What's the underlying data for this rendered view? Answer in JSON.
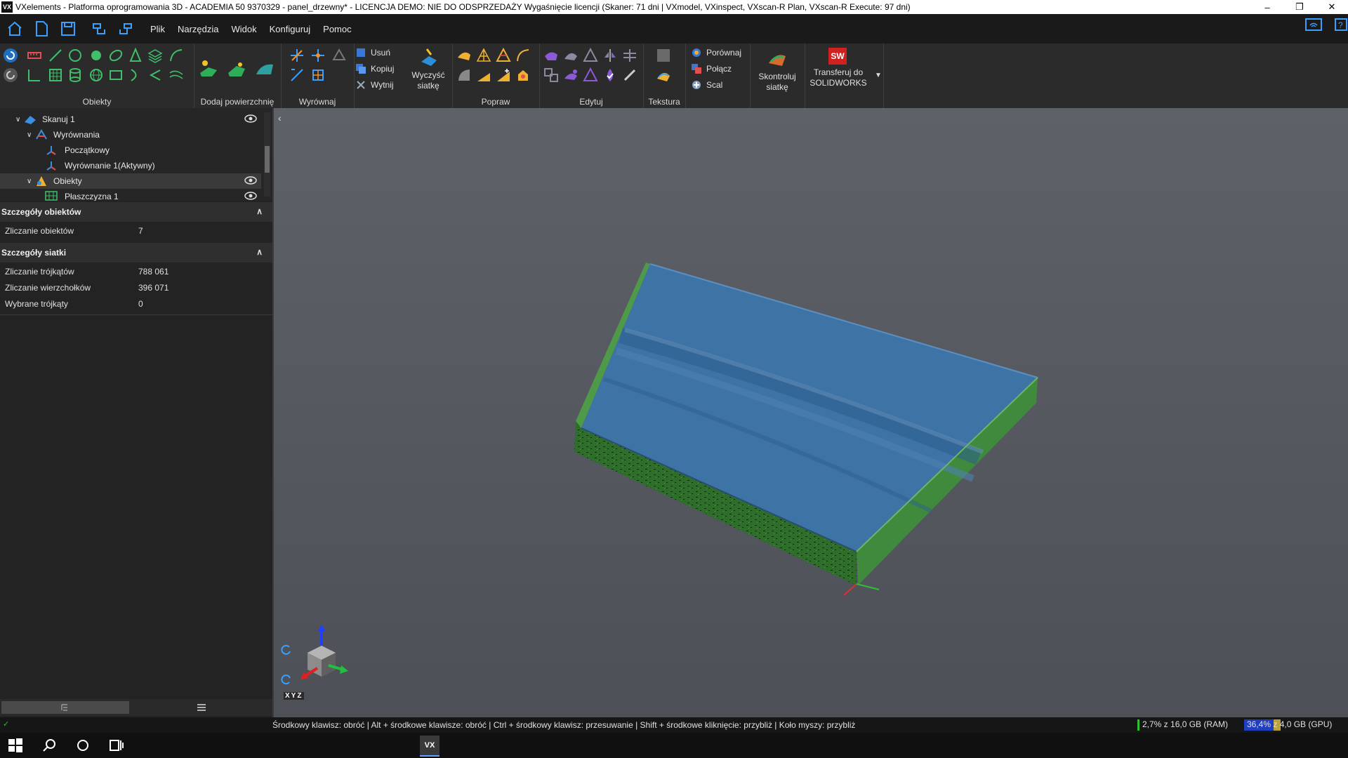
{
  "app": {
    "logo": "VX",
    "title": "VXelements - Platforma oprogramowania 3D - ACADEMIA 50 9370329 - panel_drzewny* - LICENCJA DEMO: NIE DO ODSPRZEDAŻY Wygaśnięcie licencji (Skaner: 71 dni | VXmodel, VXinspect, VXscan-R Plan, VXscan-R Execute: 97 dni)"
  },
  "menu": [
    "Plik",
    "Narzędzia",
    "Widok",
    "Konfiguruj",
    "Pomoc"
  ],
  "ribbon": {
    "groups": {
      "obiekty": "Obiekty",
      "dodaj": "Dodaj powierzchnię",
      "wyrownaj": "Wyrównaj",
      "popraw": "Popraw",
      "edytuj": "Edytuj",
      "tekstura": "Tekstura"
    },
    "edit_small": [
      "Usuń",
      "Kopiuj",
      "Wytnij"
    ],
    "clean_mesh": [
      "Wyczyść",
      "siatkę"
    ],
    "compare_small": [
      "Porównaj",
      "Połącz",
      "Scal"
    ],
    "check_mesh": [
      "Skontroluj",
      "siatkę"
    ],
    "transfer": [
      "Transferuj do",
      "SOLIDWORKS"
    ],
    "transfer_badge": "SW"
  },
  "tree": {
    "items": [
      {
        "label": "Skanuj 1"
      },
      {
        "label": "Wyrównania"
      },
      {
        "label": "Początkowy"
      },
      {
        "label": "Wyrównanie 1(Aktywny)"
      },
      {
        "label": "Obiekty"
      },
      {
        "label": "Płaszczyzna 1"
      }
    ]
  },
  "object_details": {
    "header": "Szczegóły obiektów",
    "rows": [
      {
        "k": "Zliczanie obiektów",
        "v": "7"
      }
    ]
  },
  "mesh_details": {
    "header": "Szczegóły siatki",
    "rows": [
      {
        "k": "Zliczanie trójkątów",
        "v": "788 061"
      },
      {
        "k": "Zliczanie wierzchołków",
        "v": "396 071"
      },
      {
        "k": "Wybrane trójkąty",
        "v": "0"
      }
    ]
  },
  "viewport": {
    "axis_label": "XYZ"
  },
  "status": {
    "hint": "Środkowy klawisz: obróć  |  Alt + środkowe klawisze: obróć  |  Ctrl + środkowy klawisz: przesuwanie  |  Shift + środkowe kliknięcie: przybliż  |  Koło myszy: przybliż",
    "ram": "2,7% z 16,0 GB (RAM)",
    "gpu": "36,4% z 4,0 GB (GPU)",
    "ram_fraction": 0.027,
    "gpu_fraction": 0.364
  },
  "taskbar": {
    "app_badge": "VX"
  },
  "colors": {
    "mesh_blue": "#3f78a8",
    "mesh_green": "#3d8f3a",
    "accent": "#2b8fe0",
    "viewport_bg": "#585b62"
  }
}
